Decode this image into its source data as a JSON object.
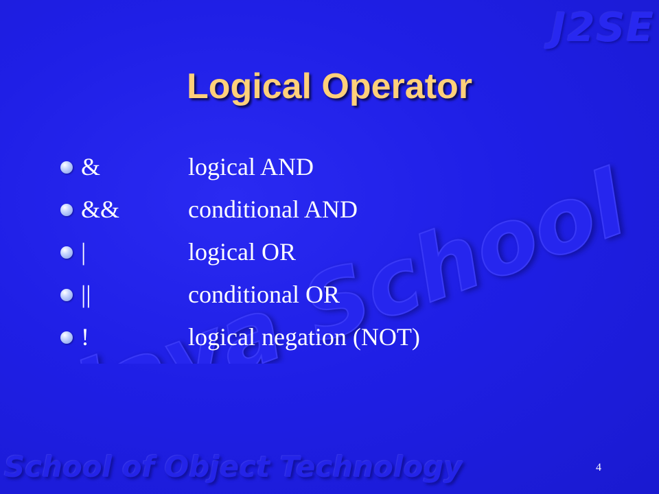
{
  "slide": {
    "title": "Logical Operator",
    "page_number": "4",
    "watermark_corner": "J2SE",
    "watermark_center": "Java School",
    "watermark_bottom": "School of Object Technology",
    "items": [
      {
        "operator": "&",
        "description": "logical AND"
      },
      {
        "operator": "&&",
        "description": "conditional AND"
      },
      {
        "operator": "|",
        "description": "logical OR"
      },
      {
        "operator": "||",
        "description": "conditional OR"
      },
      {
        "operator": "!",
        "description": "logical negation (NOT)"
      }
    ]
  },
  "colors": {
    "background": "#1f1fe6",
    "title": "#ffd07a",
    "body_text": "#ffffff"
  }
}
